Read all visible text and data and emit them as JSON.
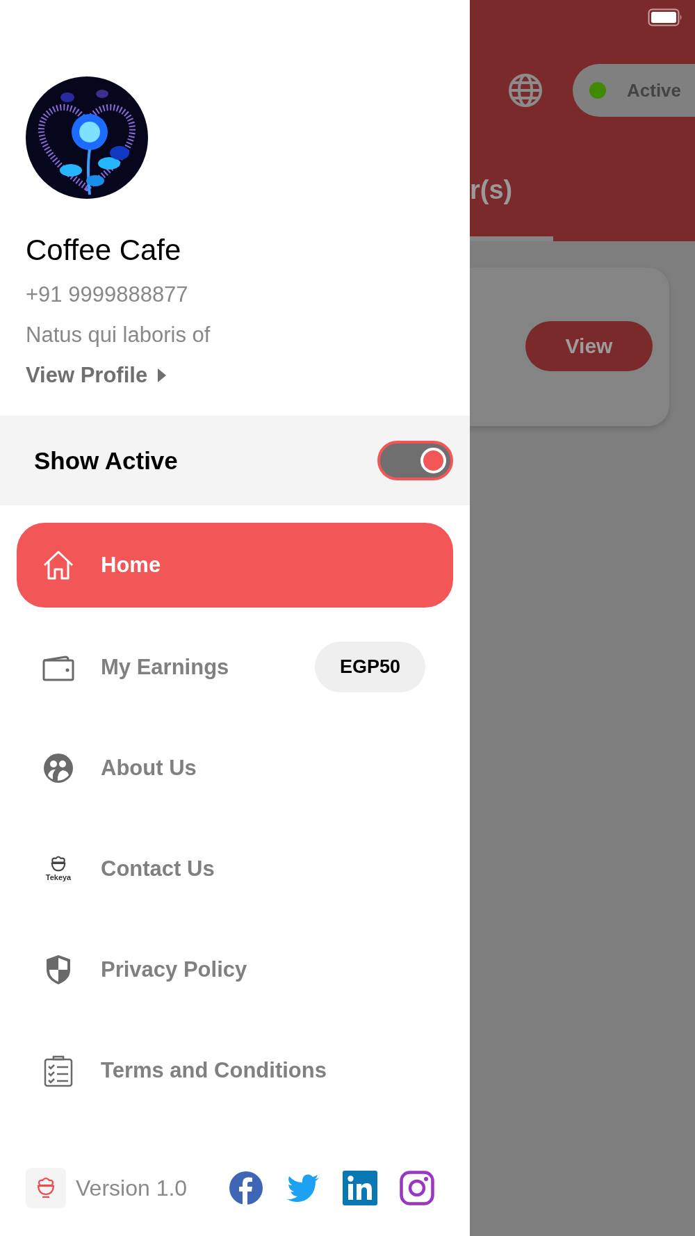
{
  "background": {
    "header": {
      "tab_label": "r(s)",
      "status": {
        "label": "Active",
        "active": true
      }
    },
    "order_card": {
      "button": "View"
    }
  },
  "drawer": {
    "profile": {
      "name": "Coffee Cafe",
      "phone": "+91 9999888877",
      "address": "Natus qui laboris of",
      "link": "View Profile"
    },
    "show_active": {
      "label": "Show Active",
      "on": true
    },
    "menu": [
      {
        "kind": "home",
        "label": "Home",
        "selected": true
      },
      {
        "kind": "wallet",
        "label": "My Earnings",
        "selected": false,
        "badge": "EGP50"
      },
      {
        "kind": "people",
        "label": "About Us",
        "selected": false
      },
      {
        "kind": "logo",
        "label": "Contact Us",
        "selected": false,
        "logo_text": "Tekeya"
      },
      {
        "kind": "shield",
        "label": "Privacy Policy",
        "selected": false
      },
      {
        "kind": "clipboard",
        "label": "Terms and Conditions",
        "selected": false
      }
    ],
    "footer": {
      "version": "Version 1.0"
    }
  }
}
